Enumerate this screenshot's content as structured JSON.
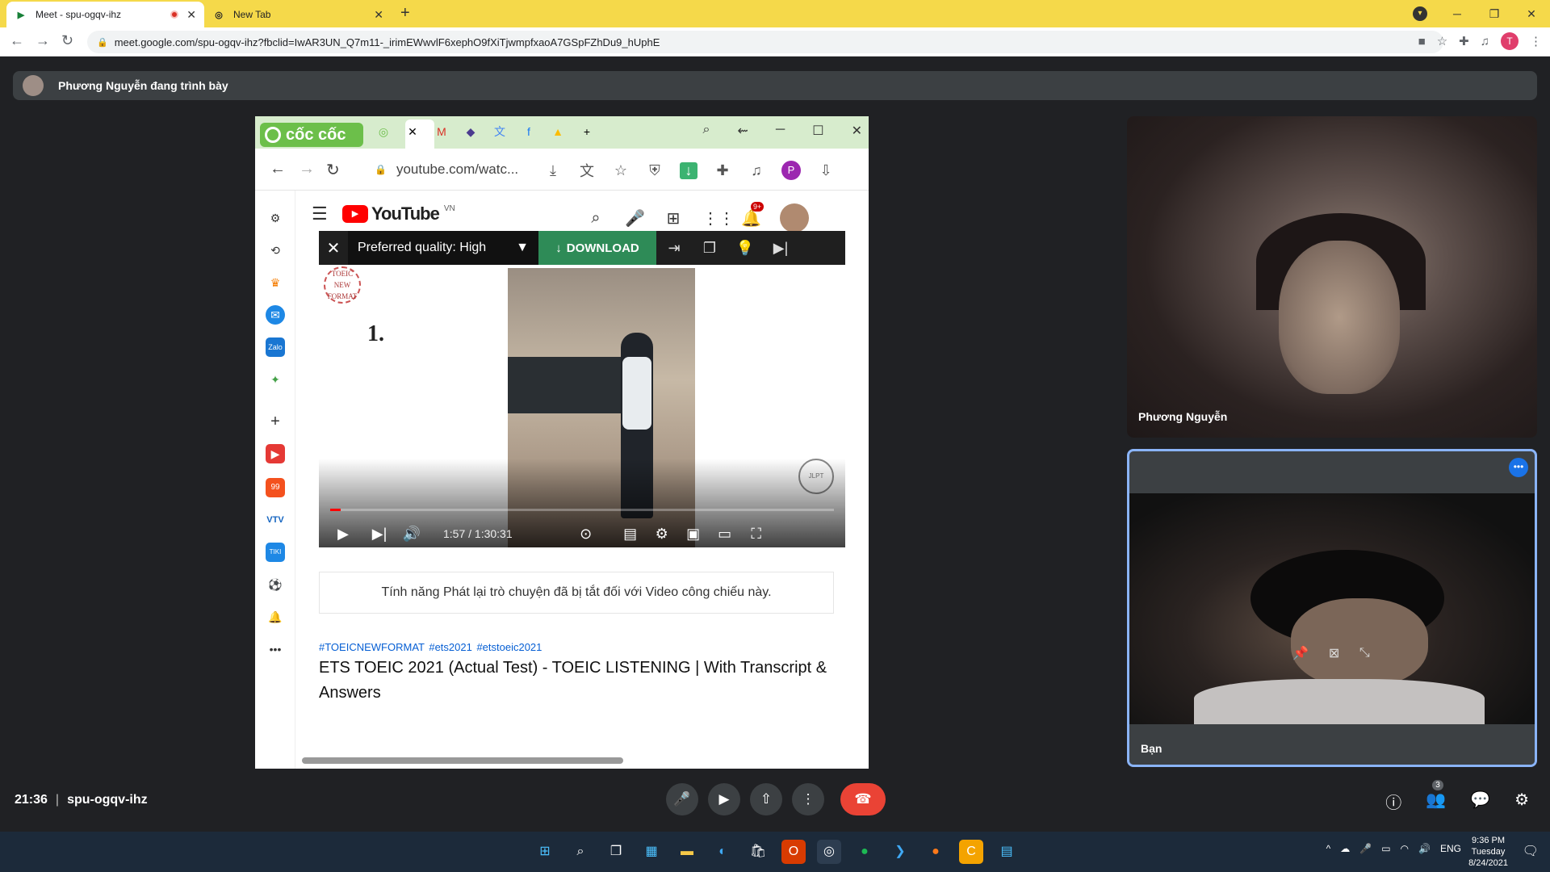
{
  "browser": {
    "tabs": [
      {
        "title": "Meet - spu-ogqv-ihz",
        "active": true
      },
      {
        "title": "New Tab",
        "active": false
      }
    ],
    "url": "meet.google.com/spu-ogqv-ihz?fbclid=IwAR3UN_Q7m11-_irimEWwvlF6xephO9fXiTjwmpfxaoA7GSpFZhDu9_hUphE",
    "profile_initial": "T"
  },
  "meet": {
    "presenting_banner": "Phương Nguyễn đang trình bày",
    "time": "21:36",
    "meeting_code": "spu-ogqv-ihz",
    "participants": [
      {
        "name": "Phương Nguyễn"
      },
      {
        "name": "Bạn"
      }
    ],
    "participant_count": "3"
  },
  "shared_screen": {
    "browser_logo": "cốc cốc",
    "url": "youtube.com/watc...",
    "profile_initial": "P",
    "youtube": {
      "logo_text": "YouTube",
      "region": "VN",
      "notification_badge": "9+",
      "downloader": {
        "quality_label": "Preferred quality: High",
        "download_label": "DOWNLOAD"
      },
      "video": {
        "question_number": "1.",
        "toeic_badge": "TOEIC NEW FORMAT",
        "time": "1:57 / 1:30:31",
        "progress_fraction": 0.0216
      },
      "chat_replay_notice": "Tính năng Phát lại trò chuyện đã bị tắt đối với Video công chiếu này.",
      "hashtags": "#TOEICNEWFORMAT #ets2021 #etstoeic2021",
      "title": "ETS TOEIC 2021 (Actual Test) - TOEIC LISTENING | With Transcript & Answers"
    }
  },
  "taskbar": {
    "language": "ENG",
    "clock_time": "9:36 PM",
    "clock_day": "Tuesday",
    "clock_date": "8/24/2021"
  }
}
